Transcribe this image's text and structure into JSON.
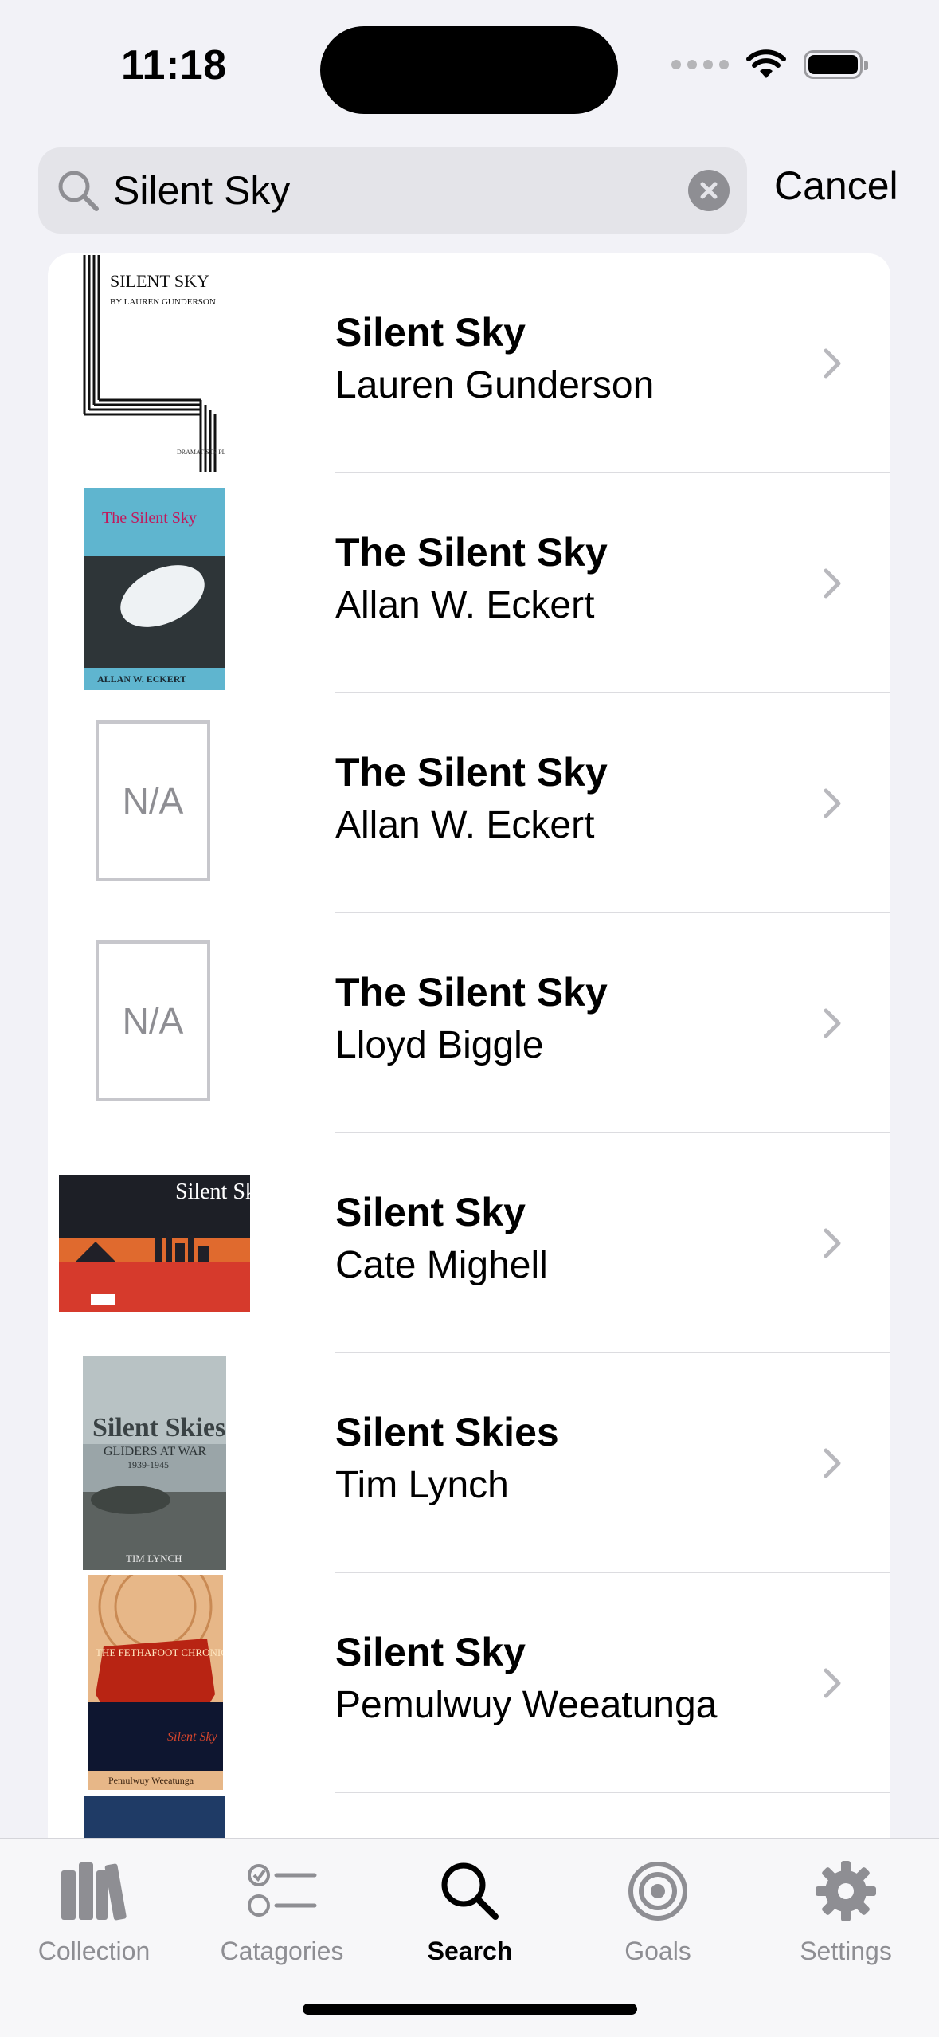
{
  "status_bar": {
    "time": "11:18"
  },
  "search": {
    "query": "Silent Sky",
    "cancel_label": "Cancel"
  },
  "results": [
    {
      "title": "Silent Sky",
      "author": "Lauren Gunderson",
      "cover": "gunderson",
      "cover_text": [
        "SILENT SKY",
        "BY LAUREN GUNDERSON",
        "DRAMATISTS PLAY SERVICE INC."
      ]
    },
    {
      "title": "The Silent Sky",
      "author": "Allan W. Eckert",
      "cover": "eckert",
      "cover_text": [
        "The Silent Sky",
        "ALLAN W. ECKERT"
      ]
    },
    {
      "title": "The Silent Sky",
      "author": "Allan W. Eckert",
      "cover": "na",
      "cover_text": [
        "N/A"
      ]
    },
    {
      "title": "The Silent Sky",
      "author": "Lloyd Biggle",
      "cover": "na",
      "cover_text": [
        "N/A"
      ]
    },
    {
      "title": "Silent Sky",
      "author": "Cate Mighell",
      "cover": "mighell",
      "cover_text": [
        "Silent Sky"
      ]
    },
    {
      "title": "Silent Skies",
      "author": "Tim Lynch",
      "cover": "lynch",
      "cover_text": [
        "Silent Skies",
        "GLIDERS AT WAR",
        "1939-1945",
        "TIM LYNCH"
      ]
    },
    {
      "title": "Silent Sky",
      "author": "Pemulwuy Weeatunga",
      "cover": "weeatunga",
      "cover_text": [
        "THE FETHAFOOT CHRONICLES",
        "Silent Sky",
        "Pemulwuy Weeatunga"
      ]
    }
  ],
  "tab_bar": {
    "tabs": [
      {
        "label": "Collection",
        "icon": "books-icon"
      },
      {
        "label": "Catagories",
        "icon": "checklist-icon"
      },
      {
        "label": "Search",
        "icon": "search-icon",
        "active": true
      },
      {
        "label": "Goals",
        "icon": "target-icon"
      },
      {
        "label": "Settings",
        "icon": "gear-icon"
      }
    ]
  }
}
